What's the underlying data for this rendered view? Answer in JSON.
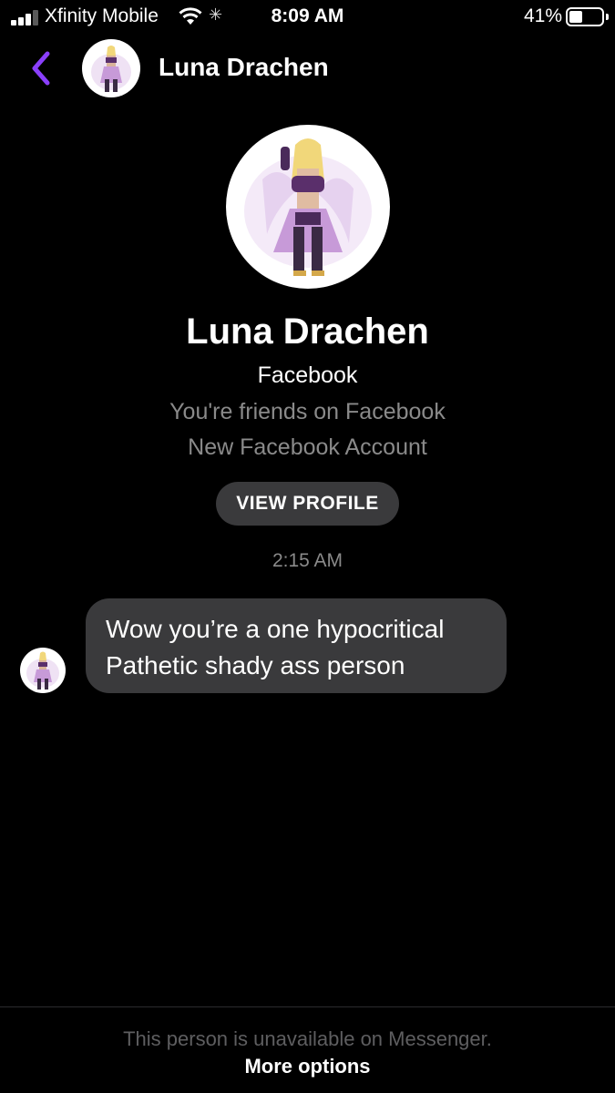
{
  "status_bar": {
    "carrier": "Xfinity Mobile",
    "time": "8:09 AM",
    "battery_percent": "41%",
    "battery_level": 0.41,
    "signal_bars": 3,
    "icons": [
      "signal-icon",
      "wifi-icon",
      "activity-spinner-icon",
      "battery-icon"
    ]
  },
  "header": {
    "back_icon": "chevron-left-icon",
    "contact_name": "Luna Drachen",
    "accent_color": "#8a3ffc"
  },
  "profile": {
    "name": "Luna Drachen",
    "platform": "Facebook",
    "friendship": "You're friends on Facebook",
    "account_note": "New Facebook Account",
    "view_profile_label": "VIEW PROFILE"
  },
  "conversation": {
    "timestamp": "2:15 AM",
    "messages": [
      {
        "line1": "Wow you’re a one hypocritical",
        "line2": "Pathetic shady ass person"
      }
    ]
  },
  "footer": {
    "note": "This person is unavailable on Messenger.",
    "more_options_label": "More options"
  }
}
